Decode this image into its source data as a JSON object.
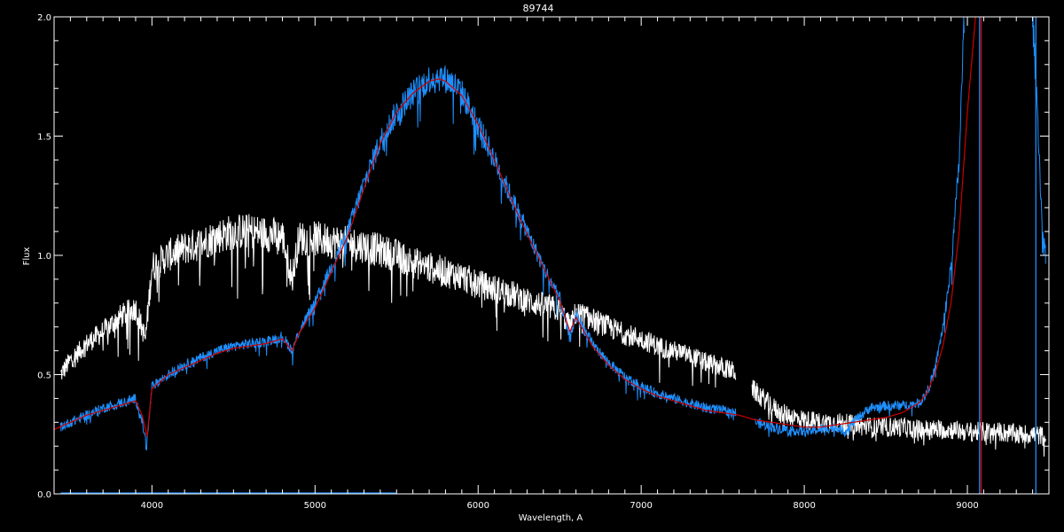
{
  "chart_data": {
    "type": "line",
    "title": "89744",
    "xlabel": "Wavelength, A",
    "ylabel": "Flux",
    "xlim": [
      3400,
      9500
    ],
    "ylim": [
      0.0,
      2.0
    ],
    "x_major_ticks": [
      4000,
      5000,
      6000,
      7000,
      8000,
      9000
    ],
    "x_tick_labels": [
      "4000",
      "5000",
      "6000",
      "7000",
      "8000",
      "9000"
    ],
    "y_major_ticks": [
      0.0,
      0.5,
      1.0,
      1.5,
      2.0
    ],
    "y_tick_labels": [
      "0.0",
      "0.5",
      "1.0",
      "1.5",
      "2.0"
    ],
    "grid": false,
    "background": "#000000",
    "axis_color": "#ffffff",
    "series": [
      {
        "color": "#ffffff",
        "noise": 0.07,
        "segments": [
          {
            "x": [
              3440,
              3500,
              3600,
              3700,
              3800,
              3900,
              3960,
              4000,
              4100,
              4200,
              4300,
              4400,
              4500,
              4600,
              4700,
              4800,
              4860,
              4900,
              5000,
              5100,
              5200,
              5300,
              5400,
              5500,
              5600,
              5700,
              5800,
              5900,
              6000,
              6100,
              6200,
              6300,
              6400,
              6500,
              6563,
              6600,
              6700,
              6800,
              6900,
              7000,
              7100,
              7200,
              7300,
              7400,
              7500,
              7580
            ],
            "y": [
              0.5,
              0.56,
              0.63,
              0.68,
              0.74,
              0.78,
              0.65,
              0.95,
              1.0,
              1.03,
              1.05,
              1.08,
              1.1,
              1.1,
              1.09,
              1.08,
              0.9,
              1.07,
              1.07,
              1.06,
              1.05,
              1.04,
              1.02,
              1.0,
              0.97,
              0.95,
              0.93,
              0.91,
              0.88,
              0.86,
              0.84,
              0.81,
              0.79,
              0.77,
              0.7,
              0.76,
              0.73,
              0.7,
              0.67,
              0.65,
              0.62,
              0.6,
              0.58,
              0.55,
              0.53,
              0.51
            ]
          },
          {
            "x": [
              7680,
              7750,
              7800,
              7850,
              7900,
              7950,
              8000,
              8100,
              8200,
              8300,
              8400,
              8500,
              8600,
              8700,
              8800,
              8900,
              9000,
              9100,
              9200,
              9300,
              9400,
              9480
            ],
            "y": [
              0.44,
              0.4,
              0.37,
              0.34,
              0.33,
              0.32,
              0.31,
              0.3,
              0.3,
              0.29,
              0.28,
              0.28,
              0.28,
              0.27,
              0.27,
              0.27,
              0.26,
              0.26,
              0.26,
              0.25,
              0.25,
              0.24
            ]
          }
        ]
      },
      {
        "color": "#1e90ff",
        "noise": 0.035,
        "segments": [
          {
            "x": [
              3440,
              3500,
              3600,
              3700,
              3800,
              3900,
              3940,
              3968,
              4000,
              4100,
              4200,
              4300,
              4400,
              4500,
              4600,
              4700,
              4800,
              4861,
              4900,
              5000,
              5100,
              5200,
              5300,
              5400,
              5500,
              5600,
              5700,
              5750,
              5800,
              5850,
              5900,
              6000,
              6100,
              6200,
              6300,
              6400,
              6500,
              6563,
              6600,
              6700,
              6800,
              6900,
              7000,
              7100,
              7200,
              7300,
              7400,
              7500,
              7580
            ],
            "y": [
              0.28,
              0.3,
              0.33,
              0.36,
              0.38,
              0.4,
              0.3,
              0.2,
              0.45,
              0.5,
              0.54,
              0.57,
              0.6,
              0.62,
              0.63,
              0.64,
              0.66,
              0.6,
              0.68,
              0.8,
              0.95,
              1.1,
              1.3,
              1.48,
              1.6,
              1.68,
              1.74,
              1.75,
              1.74,
              1.72,
              1.68,
              1.55,
              1.4,
              1.25,
              1.1,
              0.95,
              0.82,
              0.65,
              0.75,
              0.63,
              0.55,
              0.49,
              0.45,
              0.42,
              0.4,
              0.38,
              0.36,
              0.35,
              0.34
            ]
          },
          {
            "x": [
              7700,
              7800,
              7900,
              8000,
              8100,
              8200,
              8250,
              8300,
              8400,
              8500,
              8600,
              8700,
              8750,
              8800,
              8850,
              8900,
              8950,
              8980
            ],
            "y": [
              0.3,
              0.28,
              0.27,
              0.26,
              0.27,
              0.28,
              0.26,
              0.3,
              0.36,
              0.37,
              0.37,
              0.38,
              0.42,
              0.52,
              0.7,
              0.95,
              1.4,
              2.0
            ]
          },
          {
            "x": [
              9400,
              9430,
              9460,
              9480
            ],
            "y": [
              2.0,
              1.6,
              1.1,
              1.0
            ]
          }
        ]
      },
      {
        "color": "#cc0000",
        "noise": 0,
        "segments": [
          {
            "x": [
              3400,
              3500,
              3600,
              3700,
              3800,
              3900,
              3940,
              3970,
              4000,
              4100,
              4200,
              4300,
              4400,
              4500,
              4600,
              4700,
              4800,
              4860,
              4900,
              5000,
              5100,
              5200,
              5300,
              5400,
              5500,
              5600,
              5700,
              5760,
              5800,
              5900,
              6000,
              6100,
              6200,
              6300,
              6400,
              6500,
              6563,
              6600,
              6700,
              6800,
              6900,
              7000,
              7100,
              7200,
              7300,
              7400,
              7500,
              7600,
              7700,
              7800,
              7900,
              8000,
              8100,
              8200,
              8300,
              8400,
              8500,
              8600,
              8700,
              8750,
              8800,
              8850,
              8900,
              8950,
              9000,
              9050
            ],
            "y": [
              0.27,
              0.3,
              0.33,
              0.35,
              0.37,
              0.39,
              0.33,
              0.24,
              0.44,
              0.5,
              0.53,
              0.56,
              0.59,
              0.61,
              0.62,
              0.63,
              0.65,
              0.6,
              0.67,
              0.78,
              0.93,
              1.08,
              1.28,
              1.47,
              1.6,
              1.68,
              1.73,
              1.74,
              1.73,
              1.67,
              1.55,
              1.4,
              1.24,
              1.09,
              0.95,
              0.81,
              0.68,
              0.74,
              0.62,
              0.54,
              0.48,
              0.44,
              0.41,
              0.39,
              0.37,
              0.35,
              0.34,
              0.33,
              0.31,
              0.3,
              0.29,
              0.28,
              0.28,
              0.29,
              0.3,
              0.31,
              0.32,
              0.34,
              0.38,
              0.42,
              0.5,
              0.62,
              0.8,
              1.1,
              1.6,
              2.0
            ]
          }
        ]
      }
    ],
    "baseline": {
      "color": "#1e90ff",
      "x": [
        3440,
        5500
      ],
      "y": 0.0
    },
    "vertical_lines": [
      {
        "x": 9075,
        "color": "#1e90ff"
      },
      {
        "x": 9085,
        "color": "#cc0000"
      },
      {
        "x": 9420,
        "color": "#1e90ff"
      }
    ]
  }
}
